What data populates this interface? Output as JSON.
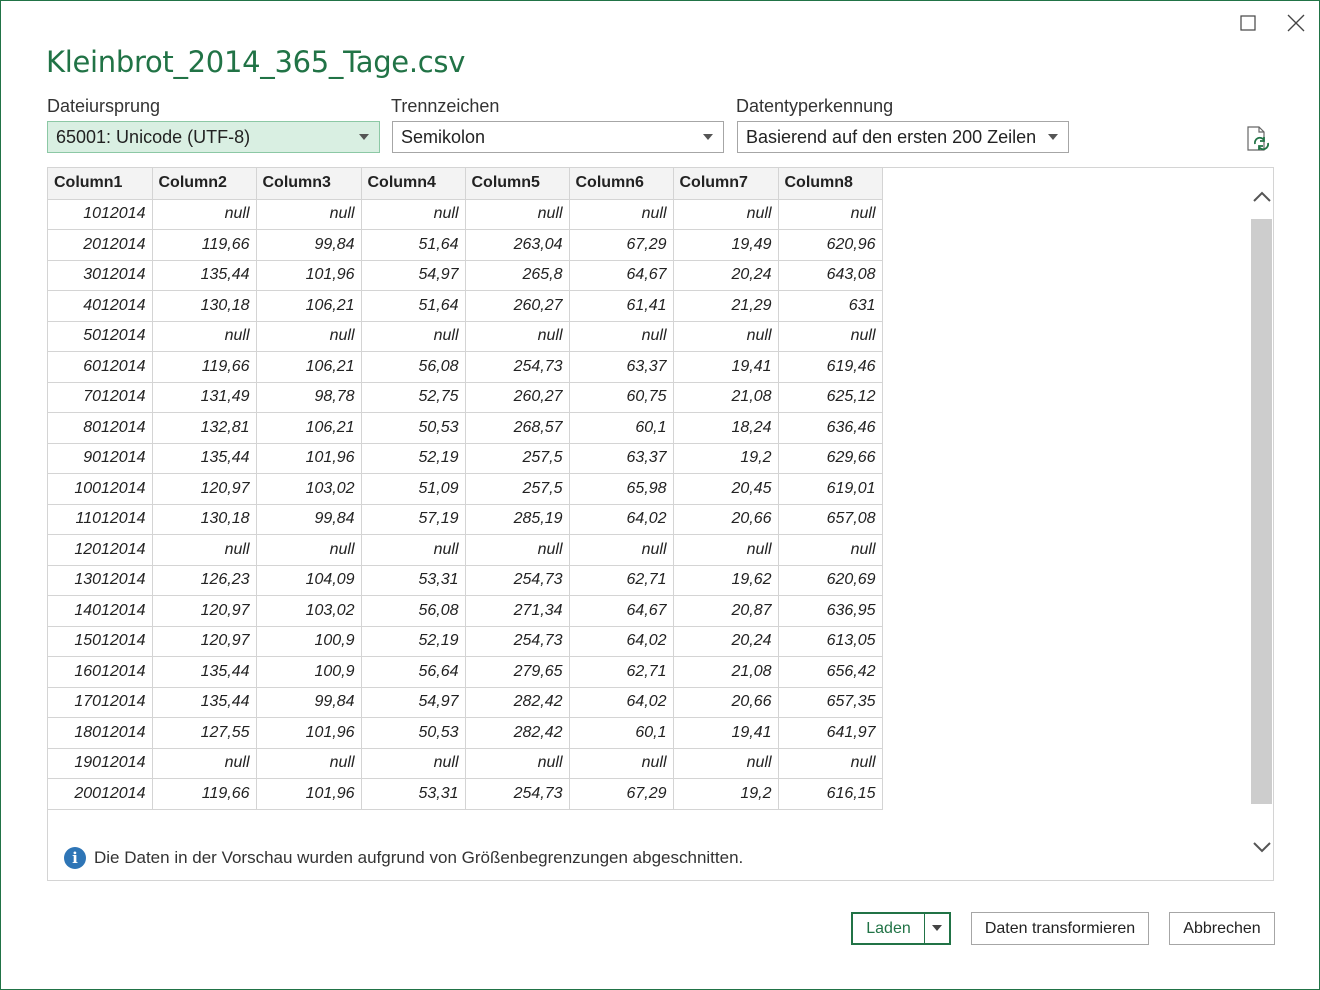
{
  "window": {
    "title": "Kleinbrot_2014_365_Tage.csv"
  },
  "options": {
    "origin_label": "Dateiursprung",
    "origin_value": "65001: Unicode (UTF-8)",
    "delimiter_label": "Trennzeichen",
    "delimiter_value": "Semikolon",
    "detection_label": "Datentyperkennung",
    "detection_value": "Basierend auf den ersten 200 Zeilen"
  },
  "table": {
    "columns": [
      "Column1",
      "Column2",
      "Column3",
      "Column4",
      "Column5",
      "Column6",
      "Column7",
      "Column8"
    ],
    "rows": [
      [
        "1012014",
        "null",
        "null",
        "null",
        "null",
        "null",
        "null",
        "null"
      ],
      [
        "2012014",
        "119,66",
        "99,84",
        "51,64",
        "263,04",
        "67,29",
        "19,49",
        "620,96"
      ],
      [
        "3012014",
        "135,44",
        "101,96",
        "54,97",
        "265,8",
        "64,67",
        "20,24",
        "643,08"
      ],
      [
        "4012014",
        "130,18",
        "106,21",
        "51,64",
        "260,27",
        "61,41",
        "21,29",
        "631"
      ],
      [
        "5012014",
        "null",
        "null",
        "null",
        "null",
        "null",
        "null",
        "null"
      ],
      [
        "6012014",
        "119,66",
        "106,21",
        "56,08",
        "254,73",
        "63,37",
        "19,41",
        "619,46"
      ],
      [
        "7012014",
        "131,49",
        "98,78",
        "52,75",
        "260,27",
        "60,75",
        "21,08",
        "625,12"
      ],
      [
        "8012014",
        "132,81",
        "106,21",
        "50,53",
        "268,57",
        "60,1",
        "18,24",
        "636,46"
      ],
      [
        "9012014",
        "135,44",
        "101,96",
        "52,19",
        "257,5",
        "63,37",
        "19,2",
        "629,66"
      ],
      [
        "10012014",
        "120,97",
        "103,02",
        "51,09",
        "257,5",
        "65,98",
        "20,45",
        "619,01"
      ],
      [
        "11012014",
        "130,18",
        "99,84",
        "57,19",
        "285,19",
        "64,02",
        "20,66",
        "657,08"
      ],
      [
        "12012014",
        "null",
        "null",
        "null",
        "null",
        "null",
        "null",
        "null"
      ],
      [
        "13012014",
        "126,23",
        "104,09",
        "53,31",
        "254,73",
        "62,71",
        "19,62",
        "620,69"
      ],
      [
        "14012014",
        "120,97",
        "103,02",
        "56,08",
        "271,34",
        "64,67",
        "20,87",
        "636,95"
      ],
      [
        "15012014",
        "120,97",
        "100,9",
        "52,19",
        "254,73",
        "64,02",
        "20,24",
        "613,05"
      ],
      [
        "16012014",
        "135,44",
        "100,9",
        "56,64",
        "279,65",
        "62,71",
        "21,08",
        "656,42"
      ],
      [
        "17012014",
        "135,44",
        "99,84",
        "54,97",
        "282,42",
        "64,02",
        "20,66",
        "657,35"
      ],
      [
        "18012014",
        "127,55",
        "101,96",
        "50,53",
        "282,42",
        "60,1",
        "19,41",
        "641,97"
      ],
      [
        "19012014",
        "null",
        "null",
        "null",
        "null",
        "null",
        "null",
        "null"
      ],
      [
        "20012014",
        "119,66",
        "101,96",
        "53,31",
        "254,73",
        "67,29",
        "19,2",
        "616,15"
      ]
    ]
  },
  "info": {
    "icon": "info-icon",
    "message": "Die Daten in der Vorschau wurden aufgrund von Größenbegrenzungen abgeschnitten."
  },
  "buttons": {
    "load": "Laden",
    "transform": "Daten transformieren",
    "cancel": "Abbrechen"
  },
  "colors": {
    "accent": "#217346",
    "active_select_bg": "#d9efe2",
    "info_icon": "#2e75b6"
  }
}
